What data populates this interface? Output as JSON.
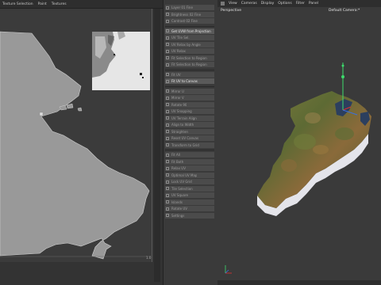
{
  "uv_editor": {
    "menu": [
      "Texture Selection",
      "Paint",
      "Textures"
    ],
    "corner_value": "1.0"
  },
  "layers": {
    "rows": [
      {
        "label": "Layer 01 Fine",
        "active": false
      },
      {
        "label": "Brightness 02 Fine",
        "active": false
      },
      {
        "label": "Contrast 02 Fine",
        "active": false
      },
      {
        "sep": true
      },
      {
        "label": "Get UVW from Projection",
        "active": true
      },
      {
        "label": "UV Tile Sel.",
        "active": false
      },
      {
        "label": "UV Relax by Angle",
        "active": false
      },
      {
        "label": "UV Relax",
        "active": false
      },
      {
        "label": "Fit Selection to Region",
        "active": false
      },
      {
        "label": "Fit Selection to Region",
        "active": false
      },
      {
        "sep": true
      },
      {
        "label": "Fit UV",
        "active": false
      },
      {
        "label": "Fit UV to Canvas",
        "active": true
      },
      {
        "sep": true
      },
      {
        "label": "Mirror U",
        "active": false
      },
      {
        "label": "Mirror V",
        "active": false
      },
      {
        "label": "Rotate 90",
        "active": false
      },
      {
        "label": "UV Snapping",
        "active": false
      },
      {
        "label": "UV Terrain Align",
        "active": false
      },
      {
        "label": "Align to Width",
        "active": false
      },
      {
        "label": "Straighten",
        "active": false
      },
      {
        "label": "Reset UV Canvas",
        "active": false
      },
      {
        "label": "Transform to Grid",
        "active": false
      },
      {
        "sep": true
      },
      {
        "label": "Fit All",
        "active": false
      },
      {
        "label": "Fit Both",
        "active": false
      },
      {
        "label": "Relax UV",
        "active": false
      },
      {
        "label": "Optimal UV Map",
        "active": false
      },
      {
        "label": "Lock UV Grid",
        "active": false
      },
      {
        "label": "Tile Selection",
        "active": false
      },
      {
        "label": "UV Square",
        "active": false
      },
      {
        "label": "Islands",
        "active": false
      },
      {
        "label": "Rotate UV",
        "active": false
      },
      {
        "label": "Settings",
        "active": false
      }
    ]
  },
  "viewport": {
    "menu": [
      "View",
      "Cameras",
      "Display",
      "Options",
      "Filter",
      "Panel"
    ],
    "title_left": "Perspective",
    "title_right": "Default Camera:*"
  },
  "colors": {
    "accent_green": "#3ddc6c",
    "axis_red": "#e03030",
    "axis_blue": "#3a6fe0",
    "terrain_side": "#e7e7ee"
  }
}
